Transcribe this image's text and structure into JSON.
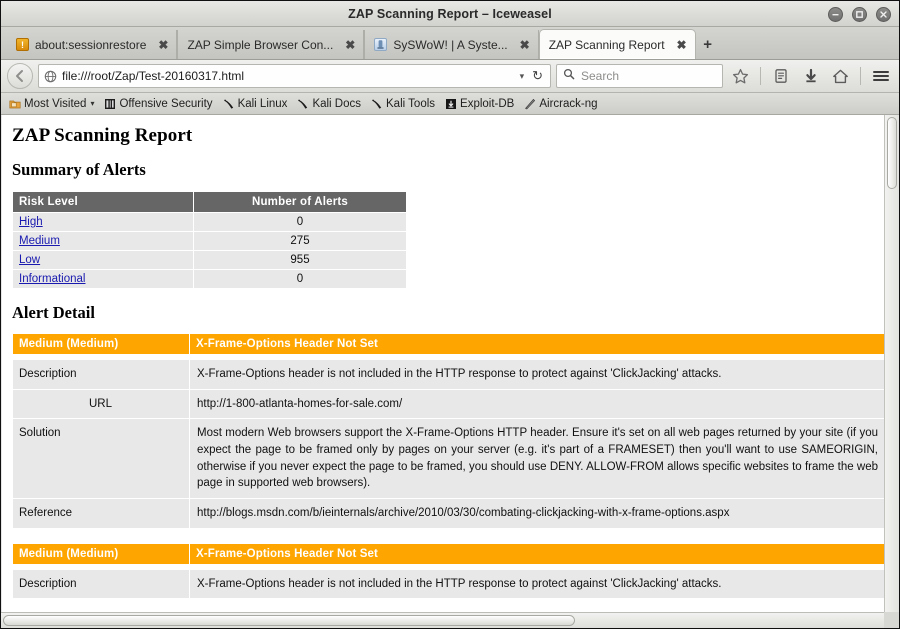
{
  "window": {
    "title": "ZAP Scanning Report – Iceweasel",
    "controls": [
      {
        "name": "minimize-button",
        "glyph": "minimize"
      },
      {
        "name": "maximize-button",
        "glyph": "maximize"
      },
      {
        "name": "close-button",
        "glyph": "close"
      }
    ]
  },
  "tabs": [
    {
      "label": "about:sessionrestore",
      "favicon": "session-restore-icon",
      "active": false,
      "close": "✖"
    },
    {
      "label": "ZAP Simple Browser Con...",
      "favicon": "none",
      "active": false,
      "close": "✖"
    },
    {
      "label": "SySWoW! | A Syste...",
      "favicon": "site-icon",
      "active": false,
      "close": "✖"
    },
    {
      "label": "ZAP Scanning Report",
      "favicon": "none",
      "active": true,
      "close": "✖"
    }
  ],
  "new_tab_label": "+",
  "navbar": {
    "back_glyph": "←",
    "url": "file:///root/Zap/Test-20160317.html",
    "url_dropdown_glyph": "▾",
    "reload_glyph": "↻",
    "search_placeholder": "Search",
    "buttons": [
      {
        "name": "bookmark-star-icon"
      },
      {
        "name": "reader-list-icon"
      },
      {
        "name": "downloads-icon"
      },
      {
        "name": "home-icon"
      },
      {
        "name": "hamburger-menu-icon"
      }
    ]
  },
  "bookmarks": [
    {
      "label": "Most Visited",
      "icon": "folder-star-icon",
      "caret": "▾"
    },
    {
      "label": "Offensive Security",
      "icon": "offsec-icon",
      "caret": ""
    },
    {
      "label": "Kali Linux",
      "icon": "kali-dragon-icon",
      "caret": ""
    },
    {
      "label": "Kali Docs",
      "icon": "kali-dragon-icon",
      "caret": ""
    },
    {
      "label": "Kali Tools",
      "icon": "kali-dragon-icon",
      "caret": ""
    },
    {
      "label": "Exploit-DB",
      "icon": "exploitdb-icon",
      "caret": ""
    },
    {
      "label": "Aircrack-ng",
      "icon": "aircrack-icon",
      "caret": ""
    }
  ],
  "report": {
    "title": "ZAP Scanning Report",
    "summary_heading": "Summary of Alerts",
    "summary_table": {
      "headers": [
        "Risk Level",
        "Number of Alerts"
      ],
      "rows": [
        {
          "level": "High",
          "count": "0"
        },
        {
          "level": "Medium",
          "count": "275"
        },
        {
          "level": "Low",
          "count": "955"
        },
        {
          "level": "Informational",
          "count": "0"
        }
      ]
    },
    "detail_heading": "Alert Detail",
    "alerts": [
      {
        "risk": "Medium (Medium)",
        "name": "X-Frame-Options Header Not Set",
        "description_label": "Description",
        "description": "X-Frame-Options header is not included in the HTTP response to protect against 'ClickJacking' attacks.",
        "url_label": "URL",
        "url": "http://1-800-atlanta-homes-for-sale.com/",
        "solution_label": "Solution",
        "solution": "Most modern Web browsers support the X-Frame-Options HTTP header. Ensure it's set on all web pages returned by your site (if you expect the page to be framed only by pages on your server (e.g. it's part of a FRAMESET) then you'll want to use SAMEORIGIN, otherwise if you never expect the page to be framed, you should use DENY. ALLOW-FROM allows specific websites to frame the web page in supported web browsers).",
        "reference_label": "Reference",
        "reference": "http://blogs.msdn.com/b/ieinternals/archive/2010/03/30/combating-clickjacking-with-x-frame-options.aspx"
      },
      {
        "risk": "Medium (Medium)",
        "name": "X-Frame-Options Header Not Set",
        "description_label": "Description",
        "description": "X-Frame-Options header is not included in the HTTP response to protect against 'ClickJacking' attacks."
      }
    ]
  },
  "colors": {
    "risk_medium": "#ffa500",
    "table_header": "#666666",
    "row_bg": "#e8e8e8",
    "link": "#1a1ab0"
  }
}
